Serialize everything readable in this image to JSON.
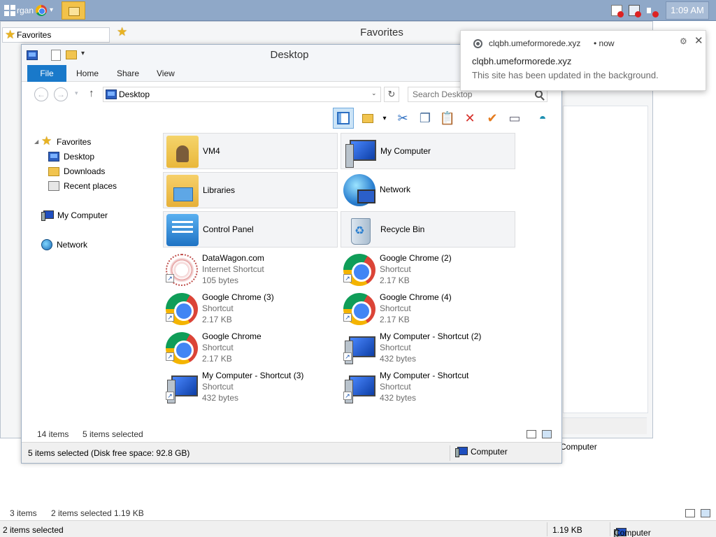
{
  "taskbar": {
    "clipped_text": "rgan",
    "clock": "1:09 AM"
  },
  "background_window": {
    "tab_label": "Favorites",
    "title": "Favorites",
    "status_text": "Computer"
  },
  "window": {
    "title": "Desktop",
    "ribbon_tabs": [
      "File",
      "Home",
      "Share",
      "View"
    ],
    "address": "Desktop",
    "search_placeholder": "Search Desktop"
  },
  "nav_pane": {
    "favorites": "Favorites",
    "desktop": "Desktop",
    "downloads": "Downloads",
    "recent": "Recent places",
    "my_computer": "My Computer",
    "network": "Network"
  },
  "tiles": [
    {
      "name": "VM4"
    },
    {
      "name": "My Computer"
    },
    {
      "name": "Libraries"
    },
    {
      "name": "Network"
    },
    {
      "name": "Control Panel"
    },
    {
      "name": "Recycle Bin"
    }
  ],
  "files": [
    {
      "name": "DataWagon.com",
      "type": "Internet Shortcut",
      "size": "105 bytes"
    },
    {
      "name": "Google Chrome (2)",
      "type": "Shortcut",
      "size": "2.17 KB"
    },
    {
      "name": "Google Chrome (3)",
      "type": "Shortcut",
      "size": "2.17 KB"
    },
    {
      "name": "Google Chrome (4)",
      "type": "Shortcut",
      "size": "2.17 KB"
    },
    {
      "name": "Google Chrome",
      "type": "Shortcut",
      "size": "2.17 KB"
    },
    {
      "name": "My Computer - Shortcut (2)",
      "type": "Shortcut",
      "size": "432 bytes"
    },
    {
      "name": "My Computer - Shortcut (3)",
      "type": "Shortcut",
      "size": "432 bytes"
    },
    {
      "name": "My Computer - Shortcut",
      "type": "Shortcut",
      "size": "432 bytes"
    }
  ],
  "item_status": {
    "count": "14 items",
    "selected": "5 items selected"
  },
  "status_bar": {
    "left": "5 items selected (Disk free space: 92.8 GB)",
    "right": "Computer"
  },
  "bottom_window": {
    "count": "3 items",
    "selected": "2 items selected",
    "size": "1.19 KB",
    "status_left": "2 items selected",
    "status_size": "1.19 KB",
    "status_right": "Computer"
  },
  "notification": {
    "origin": "clqbh.umeformorede.xyz",
    "time": "•  now",
    "title": "clqbh.umeformorede.xyz",
    "body": "This site has been updated in the background."
  }
}
